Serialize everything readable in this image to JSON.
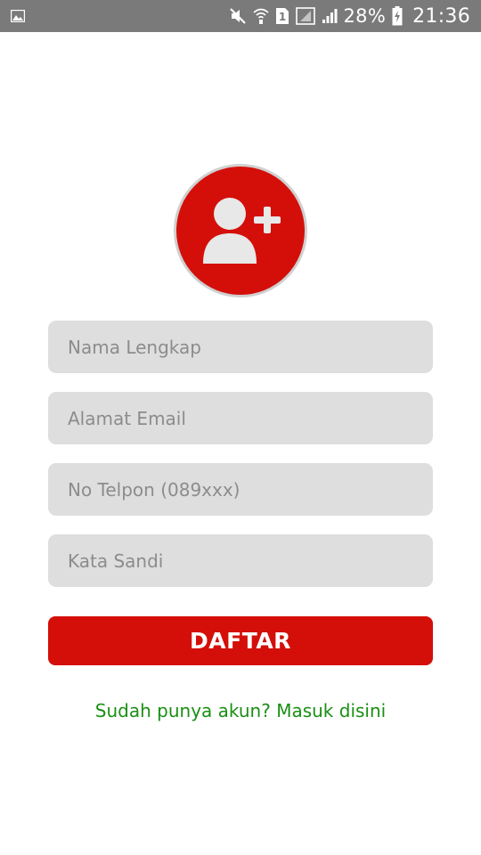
{
  "status_bar": {
    "battery": "28%",
    "time": "21:36",
    "sim_label": "1",
    "icons": [
      "image-icon",
      "mute-icon",
      "wifi-icon",
      "sim-icon",
      "signal-icon",
      "signal-icon",
      "battery-icon"
    ]
  },
  "avatar": {
    "icon": "add-user-icon",
    "color": "#d40f0a"
  },
  "form": {
    "name_placeholder": "Nama Lengkap",
    "email_placeholder": "Alamat Email",
    "phone_placeholder": "No Telpon (089xxx)",
    "password_placeholder": "Kata Sandi",
    "name_value": "",
    "email_value": "",
    "phone_value": "",
    "password_value": ""
  },
  "register_button": {
    "label": "DAFTAR",
    "color": "#d40f0a"
  },
  "login_link": {
    "label": "Sudah punya akun? Masuk disini",
    "color": "#1a8f14"
  }
}
